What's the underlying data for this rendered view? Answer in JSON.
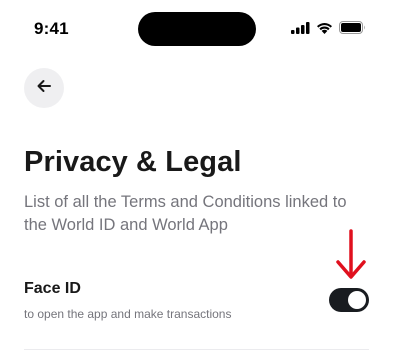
{
  "status_bar": {
    "time": "9:41",
    "icons": [
      "cellular-signal-icon",
      "wifi-icon",
      "battery-icon"
    ]
  },
  "header": {
    "back_icon": "arrow-left-icon"
  },
  "page": {
    "title": "Privacy & Legal",
    "subtitle": "List of all the Terms and Conditions linked to the World ID and World App"
  },
  "settings": {
    "face_id": {
      "label": "Face ID",
      "description": "to open the app and make transactions",
      "enabled": true
    }
  },
  "annotation": {
    "icon": "red-down-arrow-icon",
    "color": "#e0101e"
  },
  "colors": {
    "title": "#191919",
    "secondary_text": "#75757c",
    "toggle_on": "#191c20",
    "back_button_bg": "#efeff1"
  }
}
